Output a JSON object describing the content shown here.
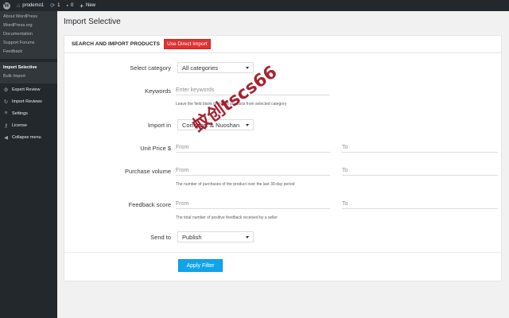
{
  "adminbar": {
    "site_name": "prodemo1",
    "updates_count": "1",
    "comments_count": "0",
    "new_label": "New"
  },
  "sidebar": {
    "wp_links": [
      "About WordPress",
      "WordPress.org",
      "Documentation",
      "Support Forums",
      "Feedback"
    ],
    "current_items": [
      "Import Selective",
      "Bulk Import"
    ],
    "menu": [
      {
        "label": "Expert Review",
        "icon": "gear-icon"
      },
      {
        "label": "Import Reviews",
        "icon": "refresh-icon"
      },
      {
        "label": "Settings",
        "icon": "sliders-icon"
      },
      {
        "label": "License",
        "icon": "key-icon"
      },
      {
        "label": "Collapse menu",
        "icon": "collapse-icon"
      }
    ]
  },
  "page": {
    "title": "Import Selective"
  },
  "panel": {
    "heading": "SEARCH AND IMPORT PRODUCTS",
    "direct_button": "Use Direct Import",
    "apply_button": "Apply Filter"
  },
  "form": {
    "category": {
      "label": "Select category",
      "value": "All categories"
    },
    "keywords": {
      "label": "Keywords",
      "placeholder": "Enter keywords",
      "hint": "Leave the field blank to import products from selected category"
    },
    "import_in": {
      "label": "Import in",
      "value": "Computer & Nuoshan"
    },
    "unit_price": {
      "label": "Unit Price $",
      "from": "From",
      "to": "To"
    },
    "purchase_volume": {
      "label": "Purchase volume",
      "from": "From",
      "to": "To",
      "hint": "The number of purchases of the product over the last 30-day period"
    },
    "feedback_score": {
      "label": "Feedback score",
      "from": "From",
      "to": "To",
      "hint": "The total number of positive feedback received by a seller"
    },
    "send_to": {
      "label": "Send to",
      "value": "Publish"
    }
  },
  "watermark": "蚊创tscs66",
  "colors": {
    "admin_dark": "#23282d",
    "direct_button": "#e03131",
    "apply_button": "#0ea5ea"
  }
}
